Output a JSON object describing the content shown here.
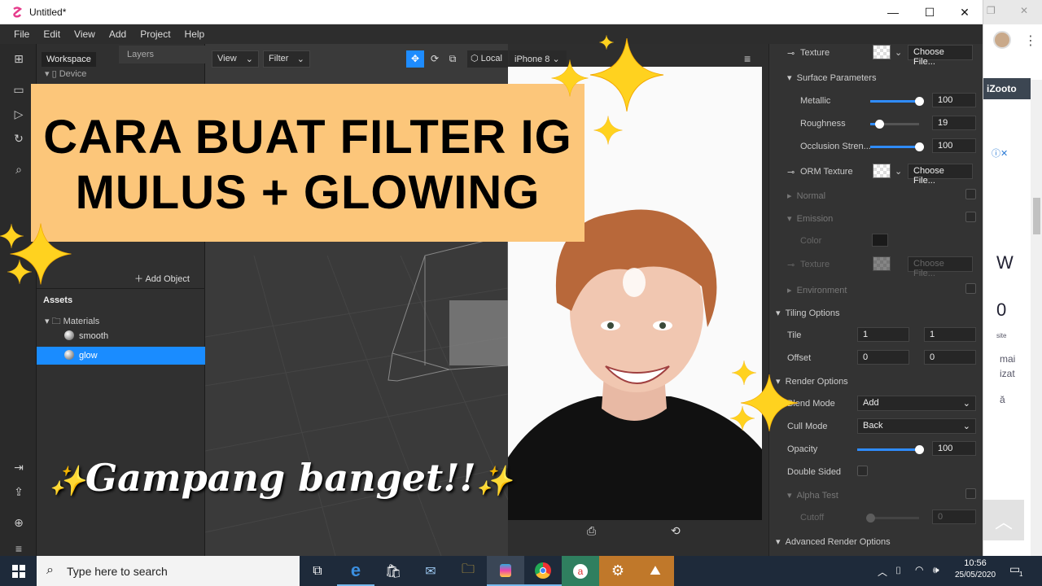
{
  "window": {
    "title": "Untitled*",
    "min": "—",
    "max": "☐",
    "close": "✕"
  },
  "menu": [
    "File",
    "Edit",
    "View",
    "Add",
    "Project",
    "Help"
  ],
  "scene": {
    "tab_workspace": "Workspace",
    "tab_layers": "Layers",
    "device": "Device",
    "add_object": "Add Object",
    "assets_header": "Assets",
    "materials": "Materials",
    "items": [
      "smooth",
      "glow"
    ],
    "selected": "glow"
  },
  "viewport": {
    "view_btn": "View",
    "filter_btn": "Filter",
    "local_label": "Local",
    "device_select": "iPhone 8"
  },
  "inspector": {
    "texture": {
      "label": "Texture",
      "choose": "Choose File..."
    },
    "surface_params": "Surface Parameters",
    "metallic": {
      "label": "Metallic",
      "value": "100",
      "unit": "%",
      "level": 1.0
    },
    "roughness": {
      "label": "Roughness",
      "value": "19",
      "unit": "%",
      "level": 0.19
    },
    "occlusion": {
      "label": "Occlusion Stren...",
      "value": "100",
      "unit": "%",
      "level": 1.0
    },
    "orm_texture": {
      "label": "ORM Texture",
      "choose": "Choose File..."
    },
    "normal": "Normal",
    "emission": "Emission",
    "emission_color": "Color",
    "emission_texture": {
      "label": "Texture",
      "choose": "Choose File..."
    },
    "environment": "Environment",
    "tiling_options": "Tiling Options",
    "tile": {
      "label": "Tile",
      "x": "1",
      "y": "1"
    },
    "offset": {
      "label": "Offset",
      "x": "0",
      "y": "0"
    },
    "render_options": "Render Options",
    "blend_mode": {
      "label": "Blend Mode",
      "value": "Add"
    },
    "cull_mode": {
      "label": "Cull Mode",
      "value": "Back"
    },
    "opacity": {
      "label": "Opacity",
      "value": "100",
      "unit": "%",
      "level": 1.0
    },
    "double_sided": "Double Sided",
    "alpha_test": "Alpha Test",
    "cutoff": {
      "label": "Cutoff",
      "value": "0",
      "unit": "%",
      "level": 0.0
    },
    "advanced": "Advanced Render Options"
  },
  "browser": {
    "izooto": "iZooto",
    "frag1": "W",
    "frag2": "0",
    "frag3": "site",
    "frag4": "mai",
    "frag5": "izat",
    "frag6": "ă"
  },
  "overlay": {
    "line1": "CARA BUAT FILTER IG",
    "line2": "MULUS + GLOWING",
    "tagline": "Gampang banget!!",
    "sparkle": "✨",
    "banner_color": "#fcc67a"
  },
  "taskbar": {
    "search_placeholder": "Type here to search",
    "time": "10:56",
    "date": "25/05/2020",
    "notif_count": "1"
  },
  "colors": {
    "accent": "#1e8cff",
    "selected_row": "#1a8cff"
  }
}
